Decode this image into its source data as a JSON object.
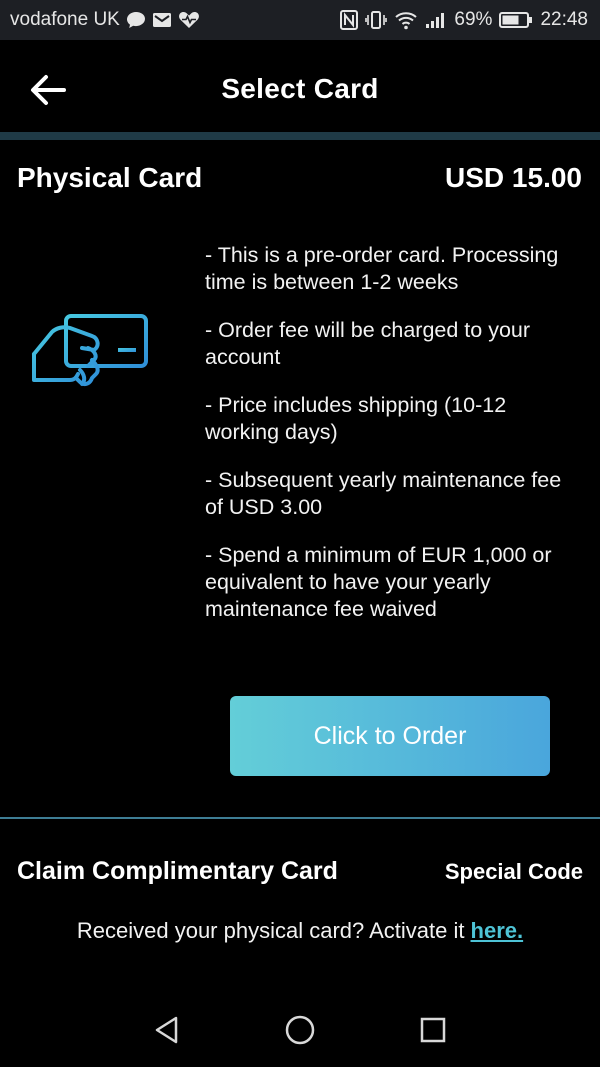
{
  "status_bar": {
    "carrier": "vodafone UK",
    "battery": "69%",
    "time": "22:48",
    "icons": [
      "chat-bubble-icon",
      "mail-icon",
      "heart-rate-icon",
      "nfc-icon",
      "vibrate-icon",
      "wifi-icon",
      "signal-icon",
      "battery-icon"
    ]
  },
  "header": {
    "title": "Select Card",
    "back_icon": "arrow-left-icon"
  },
  "card": {
    "title": "Physical Card",
    "price": "USD 15.00",
    "icon": "hand-holding-card-icon",
    "icon_color": "#3ab8e0",
    "details": [
      "- This is a pre-order card. Processing time is between 1-2 weeks",
      "- Order fee will be charged to your account",
      "- Price includes shipping (10-12 working days)",
      "- Subsequent yearly maintenance fee of USD 3.00",
      "- Spend a minimum of EUR 1,000 or equivalent to have your yearly maintenance fee waived"
    ],
    "order_button": "Click to Order"
  },
  "claim": {
    "title": "Claim Complimentary Card",
    "special_code": "Special Code"
  },
  "activate": {
    "text": "Received your physical card? Activate it",
    "link": "here."
  },
  "nav_bar": {
    "icons": [
      "nav-back-icon",
      "nav-home-icon",
      "nav-recents-icon"
    ]
  },
  "colors": {
    "accent": "#4ec3d6",
    "button_start": "#63ced8",
    "button_end": "#4aa6dc",
    "divider": "#3e7d94"
  }
}
